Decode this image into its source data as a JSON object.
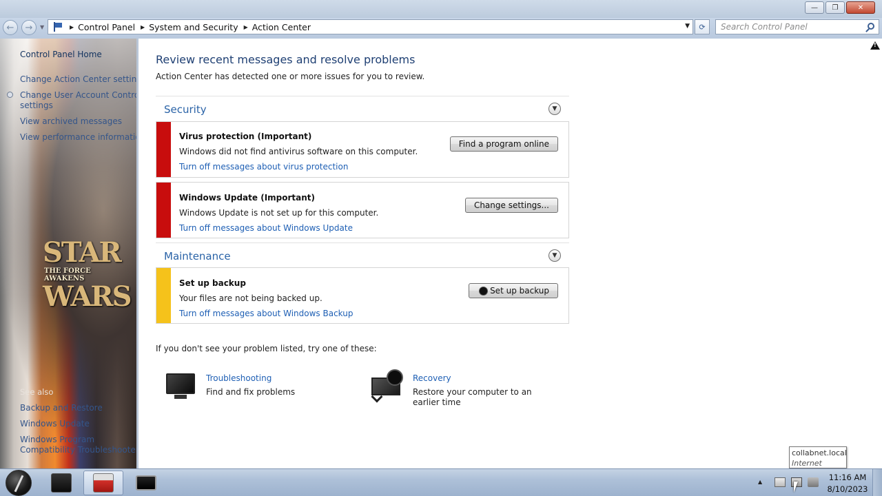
{
  "window": {
    "minimize_label": "—",
    "maximize_label": "❐",
    "close_label": "✕"
  },
  "nav": {
    "back_icon": "←",
    "forward_icon": "→",
    "breadcrumb": [
      "Control Panel",
      "System and Security",
      "Action Center"
    ],
    "refresh_icon": "⟳",
    "search_placeholder": "Search Control Panel"
  },
  "sidebar": {
    "home": "Control Panel Home",
    "items": [
      "Change Action Center settings",
      "Change User Account Control",
      "settings",
      "View archived messages",
      "View performance information"
    ],
    "see_also_label": "See also",
    "see_also": [
      "Backup and Restore",
      "Windows Update",
      "Windows Program",
      "Compatibility Troubleshooter"
    ],
    "wallpaper_text": [
      "STAR",
      "THE FORCE AWAKENS",
      "WARS"
    ]
  },
  "main": {
    "title": "Review recent messages and resolve problems",
    "subtitle": "Action Center has detected one or more issues for you to review.",
    "sections": [
      {
        "label": "Security",
        "messages": [
          {
            "title": "Virus protection  (Important)",
            "desc": "Windows did not find antivirus software on this computer.",
            "link": "Turn off messages about virus protection",
            "button": "Find a program online",
            "color": "#c80d0d"
          },
          {
            "title": "Windows Update  (Important)",
            "desc": "Windows Update is not set up for this computer.",
            "link": "Turn off messages about Windows Update",
            "button": "Change settings...",
            "color": "#c80d0d"
          }
        ]
      },
      {
        "label": "Maintenance",
        "messages": [
          {
            "title": "Set up backup",
            "desc": "Your files are not being backed up.",
            "link": "Turn off messages about Windows Backup",
            "button": "Set up backup",
            "color": "#f5c21b"
          }
        ]
      }
    ],
    "try_text": "If you don't see your problem listed, try one of these:",
    "tools": [
      {
        "link": "Troubleshooting",
        "desc": "Find and fix problems"
      },
      {
        "link": "Recovery",
        "desc": "Restore your computer to an earlier time"
      }
    ]
  },
  "tooltip": {
    "line1": "collabnet.local",
    "line2": "Internet access"
  },
  "taskbar": {
    "time": "11:16 AM",
    "date": "8/10/2023",
    "tray_expand": "▲"
  }
}
